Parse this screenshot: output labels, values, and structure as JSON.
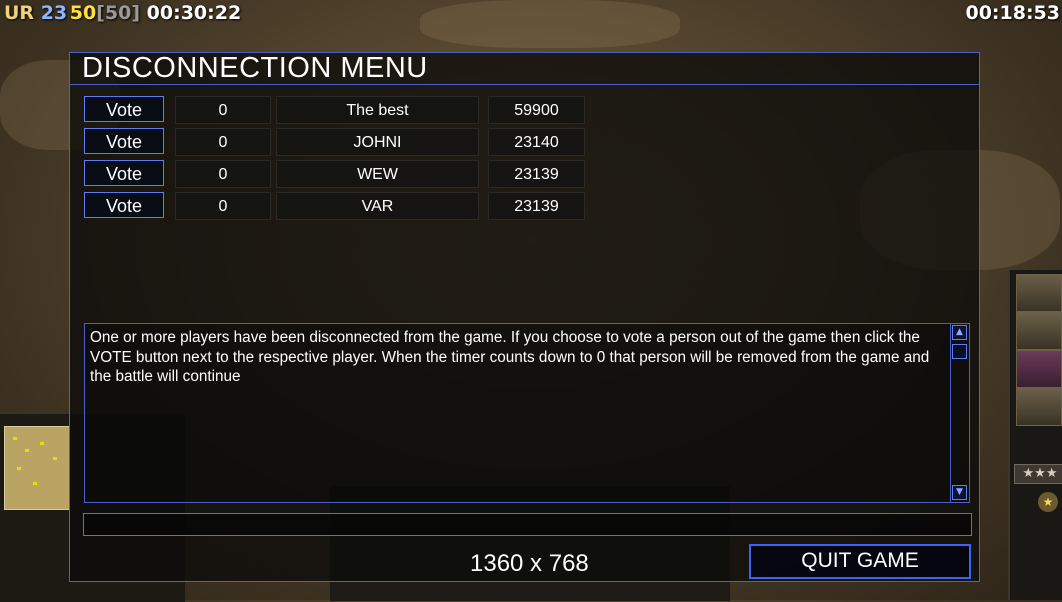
{
  "hud": {
    "faction": "UR",
    "power": "23",
    "supply_used": "50",
    "supply_cap": "[50]",
    "game_timer": "00:30:22",
    "countdown": "00:18:53"
  },
  "dialog": {
    "title": "DISCONNECTION MENU",
    "players": [
      {
        "vote_label": "Vote",
        "votes": "0",
        "name": "The best",
        "score": "59900"
      },
      {
        "vote_label": "Vote",
        "votes": "0",
        "name": "JOHNI",
        "score": "23140"
      },
      {
        "vote_label": "Vote",
        "votes": "0",
        "name": "WEW",
        "score": "23139"
      },
      {
        "vote_label": "Vote",
        "votes": "0",
        "name": "VAR",
        "score": "23139"
      }
    ],
    "message": "One or more players have been disconnected from the game. If you choose to vote a person out of the game then click the VOTE button next to the respective player. When the timer counts down to 0 that person will be removed from the game and the battle will continue",
    "chat_value": "",
    "resolution": "1360 x 768",
    "quit_label": "QUIT GAME"
  },
  "side_panel": {
    "stars": "★★★",
    "rank": "★"
  },
  "colors": {
    "accent_border": "#4b61c9",
    "button_border": "#5d7ef0",
    "quit_border": "#3c64f0"
  }
}
